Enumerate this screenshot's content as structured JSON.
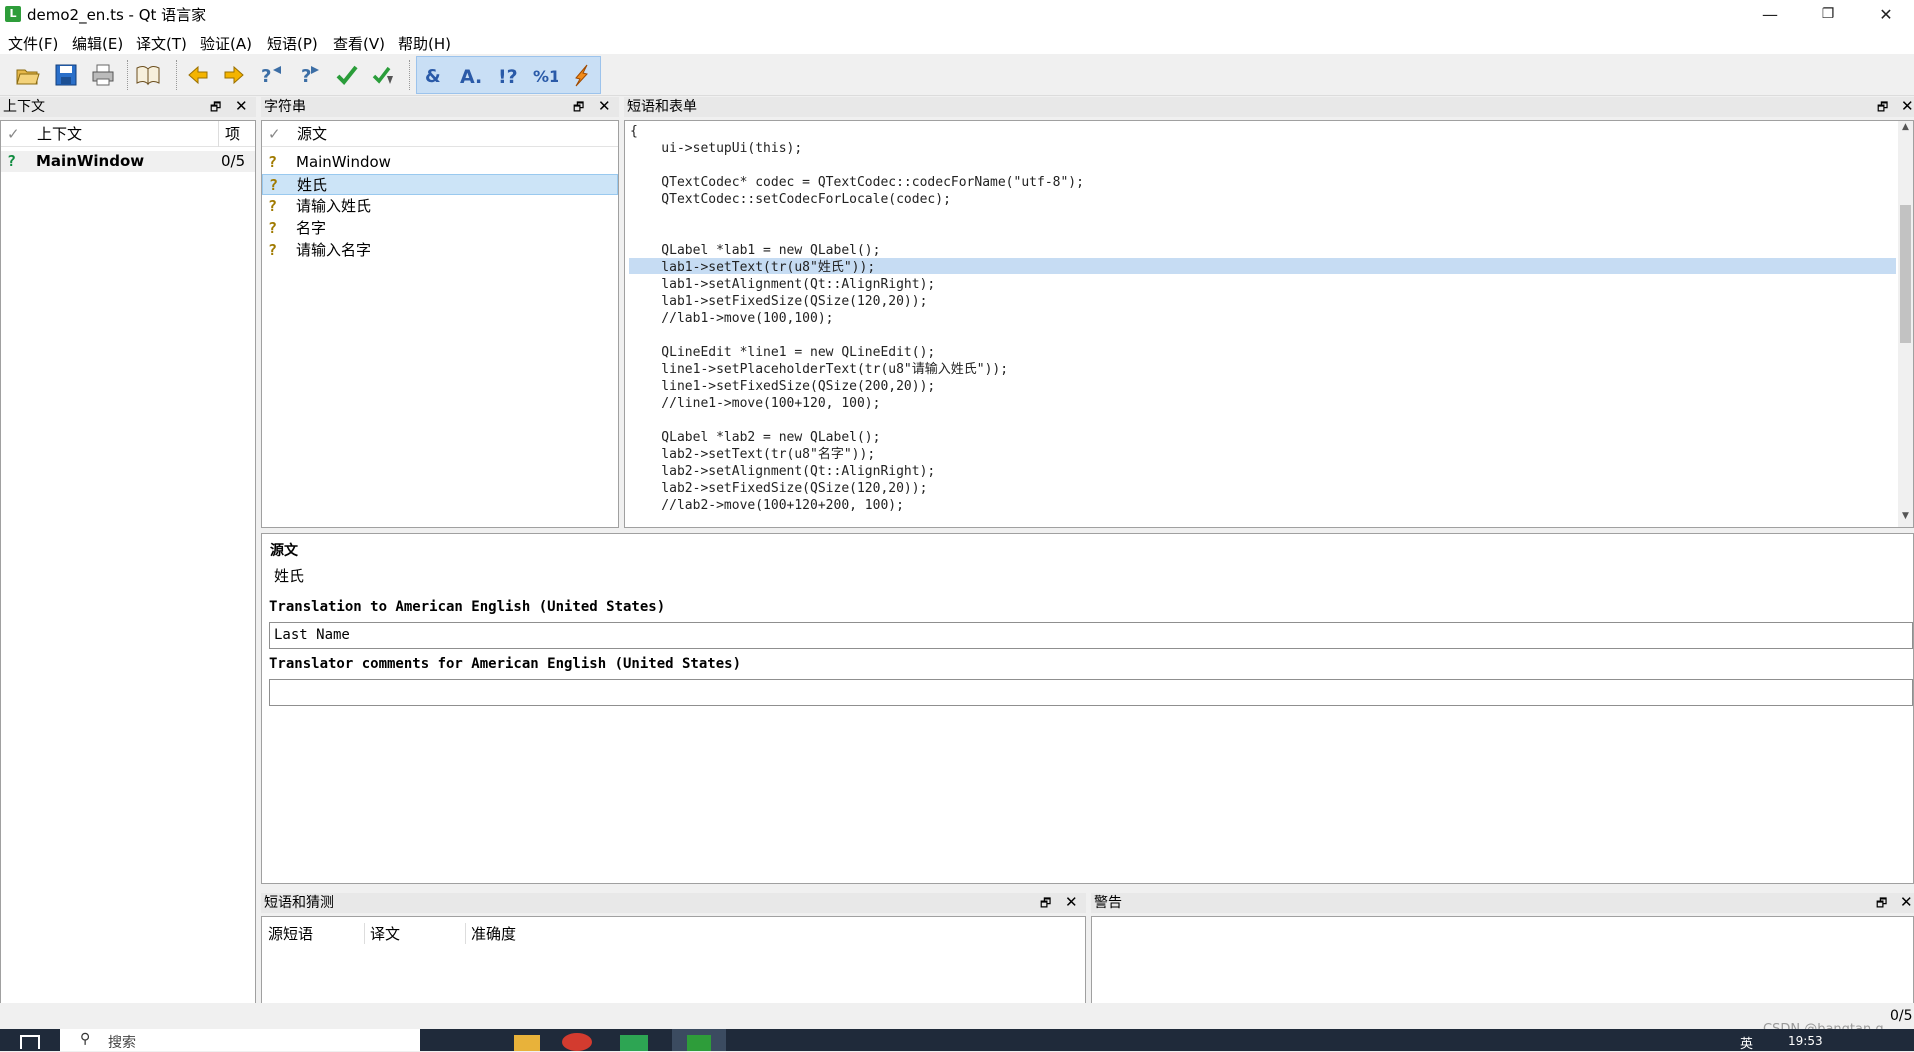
{
  "window": {
    "title": "demo2_en.ts - Qt 语言家",
    "app_icon": "L"
  },
  "menu": [
    "文件(F)",
    "编辑(E)",
    "译文(T)",
    "验证(A)",
    "短语(P)",
    "查看(V)",
    "帮助(H)"
  ],
  "context_dock": {
    "title": "上下文",
    "col_context": "上下文",
    "col_items": "项",
    "rows": [
      {
        "name": "MainWindow",
        "count": "0/5"
      }
    ]
  },
  "strings_dock": {
    "title": "字符串",
    "col_source": "源文",
    "rows": [
      "MainWindow",
      "姓氏",
      "请输入姓氏",
      "名字",
      "请输入名字"
    ]
  },
  "phrases_dock": {
    "title": "短语和表单",
    "code": [
      "{",
      "    ui->setupUi(this);",
      "",
      "    QTextCodec* codec = QTextCodec::codecForName(\"utf-8\");",
      "    QTextCodec::setCodecForLocale(codec);",
      "",
      "",
      "    QLabel *lab1 = new QLabel();",
      "    lab1->setText(tr(u8\"姓氏\"));",
      "    lab1->setAlignment(Qt::AlignRight);",
      "    lab1->setFixedSize(QSize(120,20));",
      "    //lab1->move(100,100);",
      "",
      "    QLineEdit *line1 = new QLineEdit();",
      "    line1->setPlaceholderText(tr(u8\"请输入姓氏\"));",
      "    line1->setFixedSize(QSize(200,20));",
      "    //line1->move(100+120, 100);",
      "",
      "    QLabel *lab2 = new QLabel();",
      "    lab2->setText(tr(u8\"名字\"));",
      "    lab2->setAlignment(Qt::AlignRight);",
      "    lab2->setFixedSize(QSize(120,20));",
      "    //lab2->move(100+120+200, 100);"
    ]
  },
  "editor": {
    "source_label": "源文",
    "source_text": "姓氏",
    "translation_label": "Translation to American English (United States)",
    "translation_value": "Last Name",
    "comments_label": "Translator comments for American English (United States)",
    "comments_value": ""
  },
  "guesses_dock": {
    "title": "短语和猜测",
    "col_source": "源短语",
    "col_translation": "译文",
    "col_accuracy": "准确度"
  },
  "warnings_dock": {
    "title": "警告"
  },
  "status": {
    "progress": "0/5",
    "watermark": "CSDN @bangtan.q"
  },
  "taskbar": {
    "search": "搜索",
    "time": "19:53",
    "ime": "英"
  },
  "window_controls": {
    "minimize": "—",
    "restore": "❐",
    "close": "✕"
  },
  "dock_buttons": {
    "float": "🗗",
    "close": "✕"
  },
  "colors": {
    "selection": "#cce4f7",
    "code_highlight": "#c6dcf3",
    "toolbar_highlight": "#c9dff5"
  }
}
